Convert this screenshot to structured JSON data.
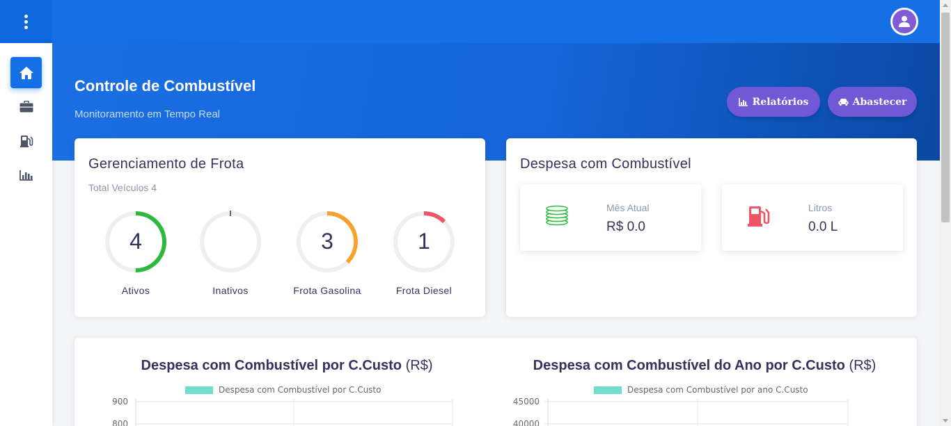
{
  "header": {
    "menu_icon": "vertical-dots-icon",
    "avatar_icon": "user-icon"
  },
  "sidebar": {
    "items": [
      {
        "icon": "home-icon",
        "active": true
      },
      {
        "icon": "briefcase-icon",
        "active": false
      },
      {
        "icon": "gas-pump-icon",
        "active": false
      },
      {
        "icon": "bar-chart-icon",
        "active": false
      }
    ]
  },
  "hero": {
    "title": "Controle de Combustível",
    "subtitle": "Monitoramento em Tempo Real",
    "buttons": {
      "reports": {
        "label": "Relatórios",
        "icon": "bar-chart-icon"
      },
      "refuel": {
        "label": "Abastecer",
        "icon": "car-icon"
      }
    }
  },
  "fleet": {
    "title": "Gerenciamento de Frota",
    "total_label": "Total Veículos 4",
    "gauges": [
      {
        "value": "4",
        "label": "Ativos",
        "fraction": 0.5,
        "color": "#2dba3c"
      },
      {
        "value": "",
        "label": "Inativos",
        "fraction": 0.0,
        "color": "#5e6a77"
      },
      {
        "value": "3",
        "label": "Frota Gasolina",
        "fraction": 0.375,
        "color": "#f8a12f"
      },
      {
        "value": "1",
        "label": "Frota Diesel",
        "fraction": 0.125,
        "color": "#ef5564"
      }
    ]
  },
  "expense": {
    "title": "Despesa com Combustível",
    "stats": {
      "month": {
        "label": "Mês Atual",
        "value": "R$ 0.0",
        "icon": "coins-icon",
        "color": "#2dba3c"
      },
      "liters": {
        "label": "Litros",
        "value": "0.0 L",
        "icon": "gas-pump-icon",
        "color": "#ef5564"
      }
    }
  },
  "charts": {
    "left": {
      "title": "Despesa com Combustível por C.Custo",
      "unit": "(R$)",
      "legend": "Despesa com Combustível por C.Custo"
    },
    "right": {
      "title": "Despesa com Combustível do Ano por C.Custo",
      "unit": "(R$)",
      "legend": "Despesa com Combustível por ano C.Custo"
    }
  },
  "chart_data": [
    {
      "type": "bar",
      "title": "Despesa com Combustível por C.Custo (R$)",
      "series": [
        {
          "name": "Despesa com Combustível por C.Custo",
          "values": []
        }
      ],
      "y_ticks": [
        "900",
        "800"
      ],
      "legend_position": "top",
      "legend_color": "#73dccd"
    },
    {
      "type": "bar",
      "title": "Despesa com Combustível do Ano por C.Custo (R$)",
      "series": [
        {
          "name": "Despesa com Combustível por ano C.Custo",
          "values": []
        }
      ],
      "y_ticks": [
        "45000",
        "40000"
      ],
      "legend_position": "top",
      "legend_color": "#73dccd"
    }
  ]
}
